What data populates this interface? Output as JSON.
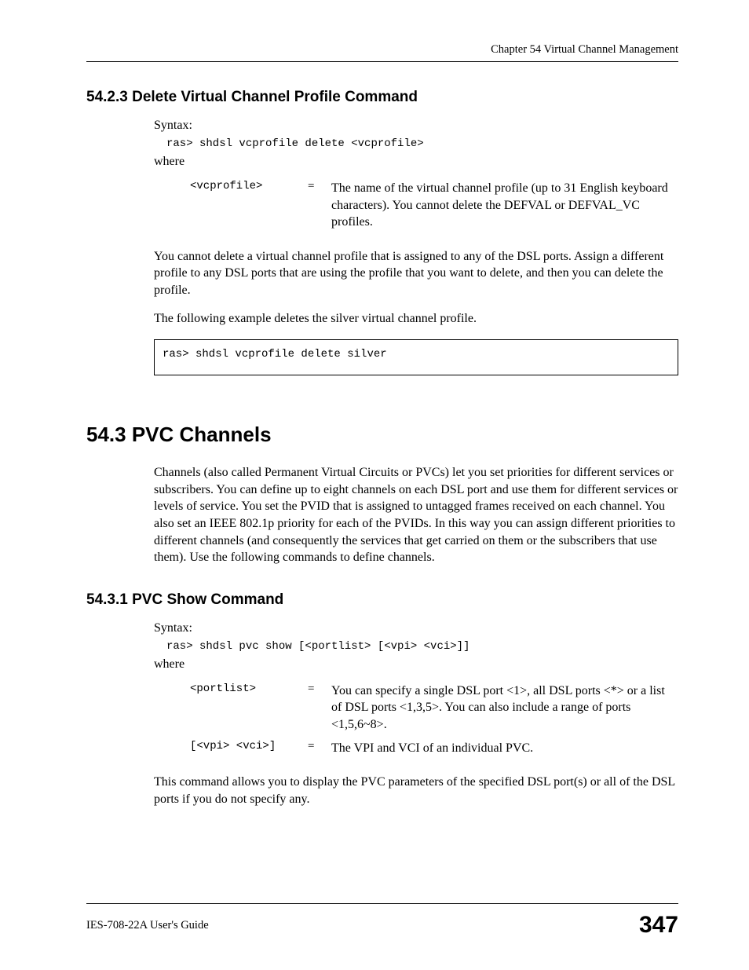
{
  "header": {
    "chapter": "Chapter 54 Virtual Channel Management"
  },
  "sec1": {
    "heading": "54.2.3  Delete Virtual Channel Profile Command",
    "syntax_label": "Syntax:",
    "syntax_cmd": "ras> shdsl vcprofile delete <vcprofile>",
    "where_label": "where",
    "params": [
      {
        "name": "<vcprofile>",
        "eq": "=",
        "desc": "The name of the virtual channel profile (up to 31 English keyboard characters). You cannot delete the DEFVAL or DEFVAL_VC profiles."
      }
    ],
    "para1": "You cannot delete a virtual channel profile that is assigned to any of the DSL ports. Assign a different profile to any DSL ports that are using the profile that you want to delete, and then you can delete the profile.",
    "para2": "The following example deletes the silver virtual channel profile.",
    "codebox": "ras> shdsl vcprofile delete silver"
  },
  "sec2": {
    "heading": "54.3  PVC Channels",
    "para": "Channels (also called Permanent Virtual Circuits or PVCs) let you set priorities for different services or subscribers. You can define up to eight channels on each DSL port and use them for different services or levels of service. You set the PVID that is assigned to untagged frames received on each channel. You also set an IEEE 802.1p priority for each of the PVIDs. In this way you can assign different priorities to different channels (and consequently the services that get carried on them or the subscribers that use them). Use the following commands to define channels."
  },
  "sec3": {
    "heading": "54.3.1  PVC Show Command",
    "syntax_label": "Syntax:",
    "syntax_cmd": "ras> shdsl pvc show [<portlist> [<vpi> <vci>]]",
    "where_label": "where",
    "params": [
      {
        "name": "<portlist>",
        "eq": "=",
        "desc": "You can specify a single DSL port <1>, all DSL ports <*> or a list of DSL ports <1,3,5>. You can also include a range of ports <1,5,6~8>."
      },
      {
        "name": "[<vpi> <vci>]",
        "eq": "=",
        "desc": "The VPI and VCI of an individual PVC."
      }
    ],
    "para": "This command allows you to display the PVC parameters of the specified DSL port(s) or all of the DSL ports if you do not specify any."
  },
  "footer": {
    "guide": "IES-708-22A User's Guide",
    "page": "347"
  }
}
